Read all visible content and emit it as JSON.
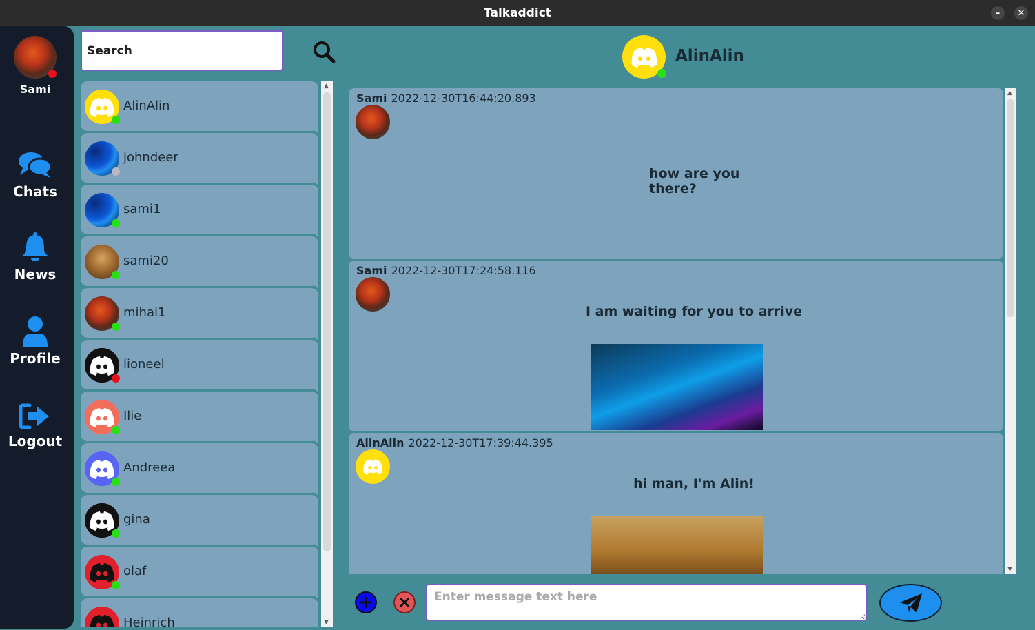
{
  "window": {
    "title": "Talkaddict"
  },
  "me": {
    "name": "Sami",
    "status": "offline"
  },
  "nav": [
    {
      "label": "Chats",
      "icon": "chats-icon"
    },
    {
      "label": "News",
      "icon": "bell-icon"
    },
    {
      "label": "Profile",
      "icon": "user-icon"
    },
    {
      "label": "Logout",
      "icon": "logout-icon"
    }
  ],
  "search": {
    "value": "Search"
  },
  "contacts": [
    {
      "name": "AlinAlin",
      "status": "online",
      "avatar": "discord-yellow"
    },
    {
      "name": "johndeer",
      "status": "away",
      "avatar": "blue-abstract"
    },
    {
      "name": "sami1",
      "status": "online",
      "avatar": "blue-abstract"
    },
    {
      "name": "sami20",
      "status": "online",
      "avatar": "forest-deer"
    },
    {
      "name": "mihai1",
      "status": "online",
      "avatar": "autumn-tree"
    },
    {
      "name": "lioneel",
      "status": "offline",
      "avatar": "discord-white"
    },
    {
      "name": "Ilie",
      "status": "online",
      "avatar": "discord-orange"
    },
    {
      "name": "Andreea",
      "status": "online",
      "avatar": "discord-blurple"
    },
    {
      "name": "gina",
      "status": "online",
      "avatar": "discord-white"
    },
    {
      "name": "olaf",
      "status": "online",
      "avatar": "discord-red"
    },
    {
      "name": "Heinrich",
      "status": "online",
      "avatar": "discord-red"
    }
  ],
  "chat": {
    "name": "AlinAlin",
    "status": "online",
    "messages": [
      {
        "sender": "Sami",
        "time": "2022-12-30T16:44:20.893",
        "text": "how are you there?",
        "image": null
      },
      {
        "sender": "Sami",
        "time": "2022-12-30T17:24:58.116",
        "text": "I am waiting for you to arrive",
        "image": "blue-abstract"
      },
      {
        "sender": "AlinAlin",
        "time": "2022-12-30T17:39:44.395",
        "text": "hi man, I'm Alin!",
        "image": "forest-deer"
      }
    ]
  },
  "composer": {
    "placeholder": "Enter message text here"
  },
  "colors": {
    "background": "#448c95",
    "nav": "#141c2b",
    "card": "#7ea3bc",
    "online": "#27e014",
    "offline": "#e8101a",
    "accent": "#1f8fef"
  }
}
